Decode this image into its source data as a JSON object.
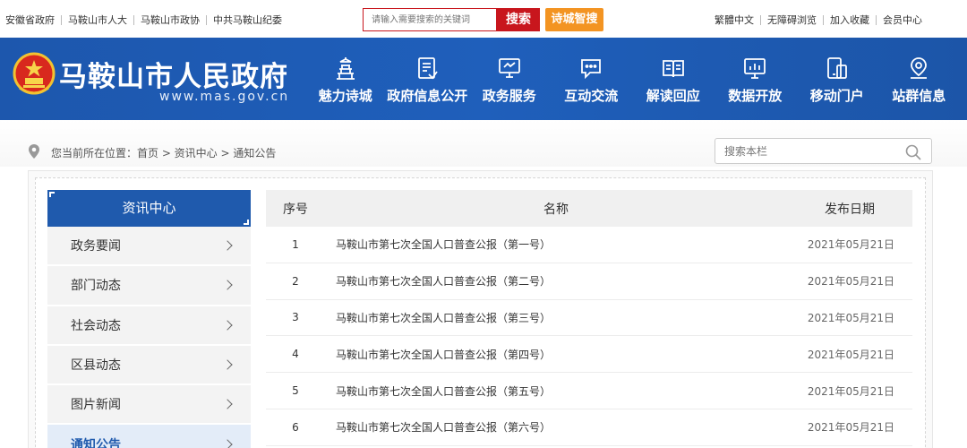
{
  "topbar": {
    "links": [
      "安徽省政府",
      "马鞍山市人大",
      "马鞍山市政协",
      "中共马鞍山纪委"
    ],
    "search_placeholder": "请输入需要搜索的关键词",
    "search_button": "搜索",
    "smart_search_button": "诗城智搜",
    "right_links": [
      "繁體中文",
      "无障碍浏览",
      "加入收藏",
      "会员中心"
    ]
  },
  "header": {
    "title": "马鞍山市人民政府",
    "url": "www.mas.gov.cn",
    "nav": [
      {
        "label": "魅力诗城",
        "icon": "tower-icon"
      },
      {
        "label": "政府信息公开",
        "icon": "document-icon"
      },
      {
        "label": "政务服务",
        "icon": "monitor-icon"
      },
      {
        "label": "互动交流",
        "icon": "chat-icon"
      },
      {
        "label": "解读回应",
        "icon": "book-icon"
      },
      {
        "label": "数据开放",
        "icon": "chart-screen-icon"
      },
      {
        "label": "移动门户",
        "icon": "mobile-icon"
      },
      {
        "label": "站群信息",
        "icon": "location-icon"
      }
    ]
  },
  "breadcrumb": {
    "text": "您当前所在位置：首页 > 资讯中心 > 通知公告",
    "search_placeholder": "搜索本栏"
  },
  "sidebar": {
    "title": "资讯中心",
    "items": [
      {
        "label": "政务要闻"
      },
      {
        "label": "部门动态"
      },
      {
        "label": "社会动态"
      },
      {
        "label": "区县动态"
      },
      {
        "label": "图片新闻"
      },
      {
        "label": "通知公告"
      }
    ]
  },
  "table": {
    "headers": {
      "no": "序号",
      "name": "名称",
      "date": "发布日期"
    },
    "rows": [
      {
        "no": "1",
        "name": "马鞍山市第七次全国人口普查公报（第一号）",
        "date": "2021年05月21日"
      },
      {
        "no": "2",
        "name": "马鞍山市第七次全国人口普查公报（第二号）",
        "date": "2021年05月21日"
      },
      {
        "no": "3",
        "name": "马鞍山市第七次全国人口普查公报（第三号）",
        "date": "2021年05月21日"
      },
      {
        "no": "4",
        "name": "马鞍山市第七次全国人口普查公报（第四号）",
        "date": "2021年05月21日"
      },
      {
        "no": "5",
        "name": "马鞍山市第七次全国人口普查公报（第五号）",
        "date": "2021年05月21日"
      },
      {
        "no": "6",
        "name": "马鞍山市第七次全国人口普查公报（第六号）",
        "date": "2021年05月21日"
      }
    ]
  },
  "colors": {
    "brand_blue": "#1f5aad",
    "search_red": "#c8161d",
    "smart_orange": "#f39422"
  }
}
